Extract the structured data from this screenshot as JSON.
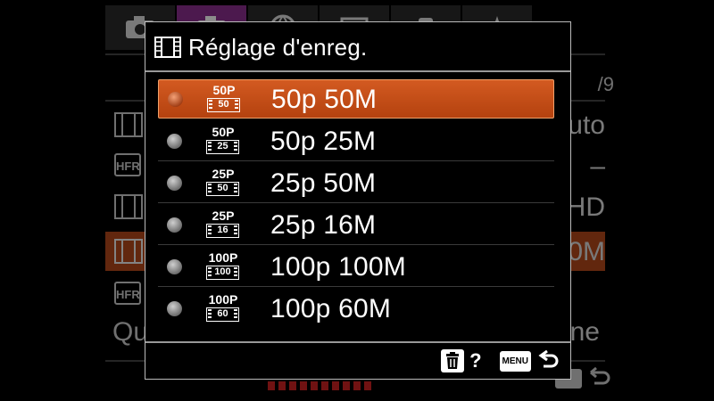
{
  "background": {
    "page_indicator": "/9",
    "rows": [
      {
        "icon": "movie-icon",
        "value": "uto"
      },
      {
        "icon": "hfr-icon",
        "icon_text": "HFR",
        "value": "–"
      },
      {
        "icon": "movie-icon",
        "value": "HD"
      },
      {
        "icon": "movie-icon",
        "value": "0M"
      },
      {
        "icon": "hfr-icon",
        "icon_text": "HFR",
        "value": ""
      }
    ],
    "bottom_left": "Qu",
    "bottom_right": "ne"
  },
  "dialog": {
    "title": "Réglage d'enreg.",
    "selected_index": 0,
    "items": [
      {
        "fps": "50P",
        "bitrate": "50",
        "label": "50p 50M"
      },
      {
        "fps": "50P",
        "bitrate": "25",
        "label": "50p 25M"
      },
      {
        "fps": "25P",
        "bitrate": "50",
        "label": "25p 50M"
      },
      {
        "fps": "25P",
        "bitrate": "16",
        "label": "25p 16M"
      },
      {
        "fps": "100P",
        "bitrate": "100",
        "label": "100p 100M"
      },
      {
        "fps": "100P",
        "bitrate": "60",
        "label": "100p 60M"
      }
    ],
    "footer": {
      "help_label": "?",
      "menu_label": "MENU"
    }
  },
  "colors": {
    "selected": "#c24e18",
    "tab_active": "#8b2f8f"
  }
}
